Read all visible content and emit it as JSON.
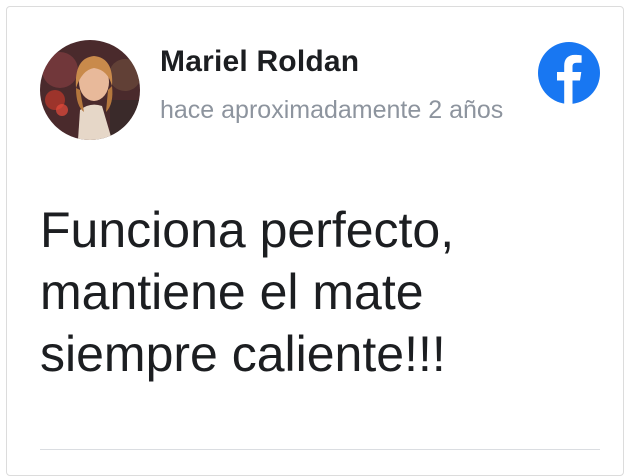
{
  "review": {
    "author_name": "Mariel Roldan",
    "timestamp": "hace aproximadamente 2 años",
    "text": "Funciona perfecto, mantiene el mate siempre caliente!!!",
    "source_icon": "facebook-icon",
    "source_color": "#1877f2"
  }
}
